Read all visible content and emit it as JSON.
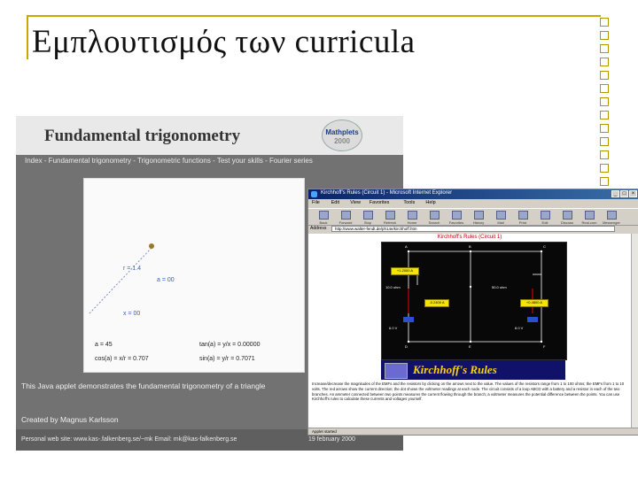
{
  "slide": {
    "title": "Εμπλουτισμός των curricula",
    "accent_color": "#c8a800"
  },
  "trig_applet": {
    "title": "Fundamental trigonometry",
    "logo_text": "Mathplets",
    "logo_year": "2000",
    "nav": "Index - Fundamental trigonometry - Trigonometric functions - Test your skills - Fourier series",
    "labels": {
      "r": "r = 1.4",
      "a": "a = 00",
      "x": "x = 00"
    },
    "values": {
      "a": "a = 45",
      "tan": "tan(a) = y/x = 0.00000",
      "cos": "cos(a) = x/r = 0.707",
      "sin": "sin(a) = y/r = 0.7071"
    },
    "description": "This Java applet demonstrates the fundamental trigonometry of a triangle",
    "created_by": "Created by Magnus Karlsson",
    "personal": "Personal web site: www.kas-.falkenberg.se/~mk Email: mk@kas-falkenberg.se",
    "date": "19 february 2000"
  },
  "ie_window": {
    "title": "Kirchhoff's Rules (Circuit 1) - Microsoft Internet Explorer",
    "menu": [
      "File",
      "Edit",
      "View",
      "Favorites",
      "Tools",
      "Help"
    ],
    "toolbar": [
      "Back",
      "Forward",
      "Stop",
      "Refresh",
      "Home",
      "Search",
      "Favorites",
      "History",
      "Mail",
      "Print",
      "Edit",
      "Discuss",
      "Real.com",
      "Messenger"
    ],
    "address_label": "Address",
    "address": "http://www.walter-fendt.de/ph14e/kirchhoff.htm",
    "status": "Applet started",
    "page_heading": "Kirchhoff's Rules (Circuit 1)",
    "banner": "Kirchhoff's Rules",
    "circuit": {
      "b1": "+1.2000 A",
      "b2": "-0.2400 A",
      "b3": "+0.4800 A",
      "r1": "10.0 ohm",
      "r2": "50.0 ohm",
      "v1": "6.0 V",
      "v2": "8.0 V",
      "nodes": [
        "A",
        "B",
        "C",
        "D",
        "E",
        "F"
      ]
    },
    "body_text": "Increase/decrease the magnitudes of the EMFs and the resistors by clicking on the arrows next to the value. The values of the resistors range from 1 to 100 ohms; the EMFs from 1 to 10 volts. The red arrows show the current direction; the dot shows the voltmeter readings at each node. The circuit consists of a loop ABCD with a battery and a resistor in each of the two branches. An ammeter connected between two points measures the current flowing through the branch; a voltmeter measures the potential difference between the points. You can use Kirchhoff's rules to calculate these currents and voltages yourself."
  }
}
